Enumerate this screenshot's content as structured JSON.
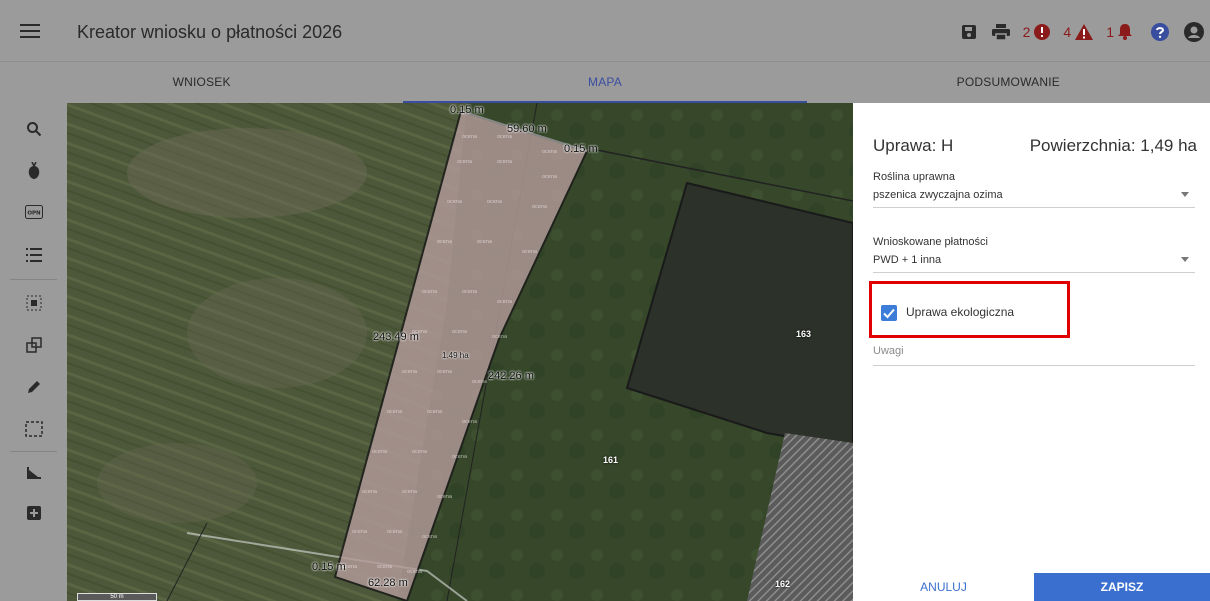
{
  "header": {
    "title": "Kreator wniosku o płatności 2026",
    "menu_icon": "hamburger-icon",
    "errors_count": "2",
    "warnings_count": "4",
    "notifications_count": "1"
  },
  "tabs": [
    {
      "label": "WNIOSEK"
    },
    {
      "label": "MAPA",
      "active": true
    },
    {
      "label": "PODSUMOWANIE"
    }
  ],
  "toolbar": {
    "icons": [
      "search-icon",
      "plant-icon",
      "opn-icon",
      "list-icon",
      "select-area-icon",
      "copy-icon",
      "pencil-icon",
      "bbox-icon",
      "measure-icon",
      "add-icon"
    ],
    "opn_label": "OPN"
  },
  "map": {
    "parcel_labels": [
      "163",
      "161",
      "162"
    ],
    "measurements": [
      "0.15 m",
      "59.60 m",
      "0.15 m",
      "243.49 m",
      "1.49 ha",
      "242.26 m",
      "0.15 m",
      "62.28 m"
    ],
    "scale": "50 m",
    "hatch_text": "ocena"
  },
  "panel": {
    "title": "Uprawa: H",
    "area": "Powierzchnia: 1,49 ha",
    "crop_label": "Roślina uprawna",
    "crop_value": "pszenica zwyczajna ozima",
    "payments_label": "Wnioskowane płatności",
    "payments_value": "PWD + 1 inna",
    "eco_label": "Uprawa ekologiczna",
    "eco_checked": true,
    "notes_placeholder": "Uwagi",
    "cancel_label": "ANULUJ",
    "save_label": "ZAPISZ"
  },
  "colors": {
    "accent": "#3a6fd0",
    "highlight": "#e00000",
    "error": "#8b1a1a",
    "help": "#3a4ea0"
  }
}
